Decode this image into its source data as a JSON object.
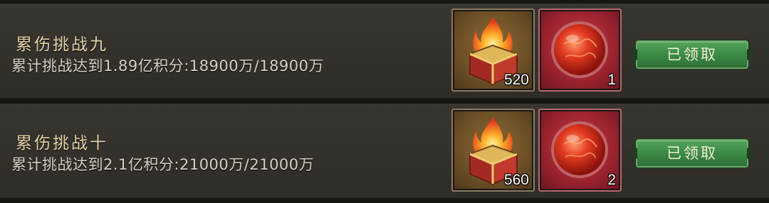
{
  "tasks": [
    {
      "title": "累伤挑战九",
      "description": "累计挑战达到1.89亿积分:18900万/18900万",
      "rewards": [
        {
          "icon": "flame-chest-icon",
          "quantity": "520"
        },
        {
          "icon": "red-orb-icon",
          "quantity": "1"
        }
      ],
      "button_label": "已领取"
    },
    {
      "title": "累伤挑战十",
      "description": "累计挑战达到2.1亿积分:21000万/21000万",
      "rewards": [
        {
          "icon": "flame-chest-icon",
          "quantity": "560"
        },
        {
          "icon": "red-orb-icon",
          "quantity": "2"
        }
      ],
      "button_label": "已领取"
    }
  ],
  "colors": {
    "title": "#e2d3a4",
    "button": "#3c8a45",
    "row_bg": "#36322e"
  }
}
